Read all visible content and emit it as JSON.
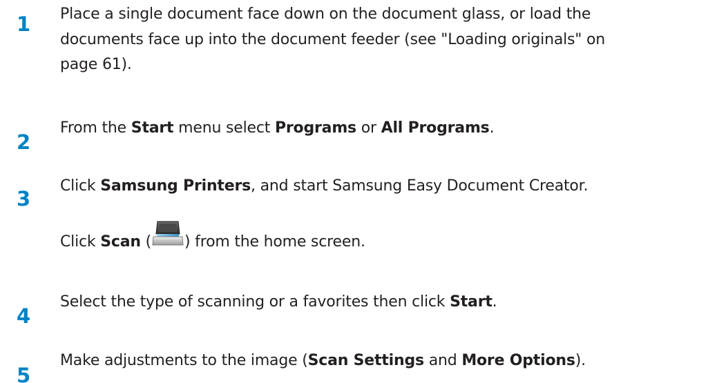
{
  "steps": [
    {
      "number": "1",
      "lines": [
        "Place a single document face down on the document glass, or load the",
        "documents face up into the document feeder (see \"Loading originals\" on",
        "page 61)."
      ]
    },
    {
      "number": "2",
      "pre": "From the ",
      "b1": "Start",
      "mid1": " menu select ",
      "b2": "Programs",
      "mid2": " or ",
      "b3": "All Programs",
      "post": "."
    },
    {
      "number": "3",
      "pre": "Click ",
      "b1": "Samsung Printers",
      "post": ", and start Samsung Easy Document Creator.",
      "sub_pre": "Click ",
      "sub_b": "Scan",
      "sub_open": " (",
      "sub_icon": "scanner-icon",
      "sub_post": ") from the home screen."
    },
    {
      "number": "4",
      "pre": "Select the type of scanning or a favorites then click ",
      "b1": "Start",
      "post": "."
    },
    {
      "number": "5",
      "pre": "Make adjustments to the image (",
      "b1": "Scan Settings",
      "mid1": " and ",
      "b2": "More Options",
      "post": ")."
    }
  ]
}
